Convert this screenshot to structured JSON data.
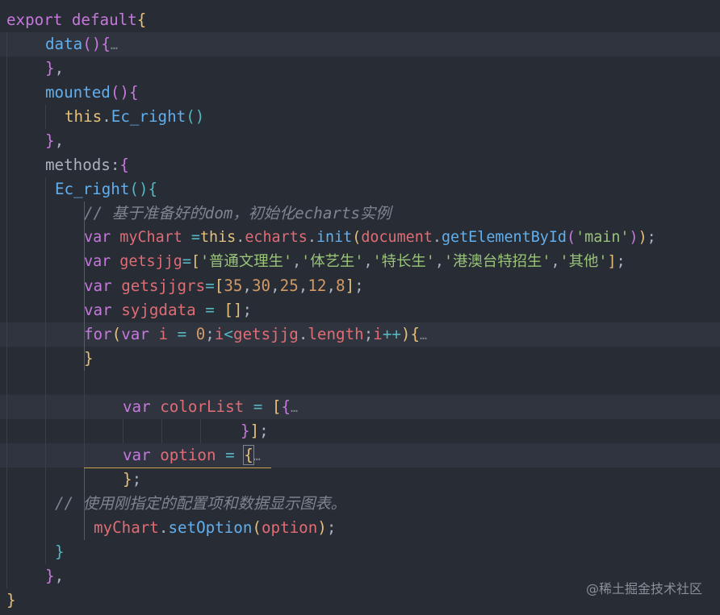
{
  "editor": {
    "lines": [
      {
        "id": "l1",
        "tokens": [
          [
            "kw",
            "export"
          ],
          [
            "plain",
            " "
          ],
          [
            "kw",
            "default"
          ],
          [
            "b1",
            "{"
          ]
        ]
      },
      {
        "id": "l2",
        "tokens": [
          [
            "fn",
            "data"
          ],
          [
            "b2",
            "()"
          ],
          [
            "b2",
            "{"
          ],
          [
            "ellipsis",
            "…"
          ]
        ]
      },
      {
        "id": "l3",
        "tokens": [
          [
            "b2",
            "}"
          ],
          [
            "plain",
            ","
          ]
        ]
      },
      {
        "id": "l4",
        "tokens": [
          [
            "fn",
            "mounted"
          ],
          [
            "b2",
            "()"
          ],
          [
            "b2",
            "{"
          ]
        ]
      },
      {
        "id": "l5",
        "tokens": [
          [
            "this",
            "this"
          ],
          [
            "plain",
            "."
          ],
          [
            "fn",
            "Ec_right"
          ],
          [
            "b3",
            "()"
          ]
        ]
      },
      {
        "id": "l6",
        "tokens": [
          [
            "b2",
            "}"
          ],
          [
            "plain",
            ","
          ]
        ]
      },
      {
        "id": "l7",
        "tokens": [
          [
            "plain",
            "methods:"
          ],
          [
            "b2",
            "{"
          ]
        ]
      },
      {
        "id": "l8",
        "tokens": [
          [
            "fn",
            "Ec_right"
          ],
          [
            "b3",
            "()"
          ],
          [
            "b3",
            "{"
          ]
        ]
      },
      {
        "id": "l9",
        "tokens": [
          [
            "cmt",
            "// 基于准备好的dom，初始化echarts实例"
          ]
        ]
      },
      {
        "id": "l10",
        "tokens": [
          [
            "kw",
            "var"
          ],
          [
            "plain",
            " "
          ],
          [
            "var",
            "myChart"
          ],
          [
            "plain",
            " "
          ],
          [
            "op",
            "="
          ],
          [
            "this",
            "this"
          ],
          [
            "plain",
            "."
          ],
          [
            "var",
            "echarts"
          ],
          [
            "plain",
            "."
          ],
          [
            "fn",
            "init"
          ],
          [
            "b1",
            "("
          ],
          [
            "var",
            "document"
          ],
          [
            "plain",
            "."
          ],
          [
            "fn",
            "getElementById"
          ],
          [
            "b2",
            "("
          ],
          [
            "str",
            "'main'"
          ],
          [
            "b2",
            ")"
          ],
          [
            "b1",
            ")"
          ],
          [
            "plain",
            ";"
          ]
        ]
      },
      {
        "id": "l11",
        "tokens": [
          [
            "kw",
            "var"
          ],
          [
            "plain",
            " "
          ],
          [
            "var",
            "getsjjg"
          ],
          [
            "op",
            "="
          ],
          [
            "b1",
            "["
          ],
          [
            "str",
            "'普通文理生'"
          ],
          [
            "plain",
            ","
          ],
          [
            "str",
            "'体艺生'"
          ],
          [
            "plain",
            ","
          ],
          [
            "str",
            "'特长生'"
          ],
          [
            "plain",
            ","
          ],
          [
            "str",
            "'港澳台特招生'"
          ],
          [
            "plain",
            ","
          ],
          [
            "str",
            "'其他'"
          ],
          [
            "b1",
            "]"
          ],
          [
            "plain",
            ";"
          ]
        ]
      },
      {
        "id": "l12",
        "tokens": [
          [
            "kw",
            "var"
          ],
          [
            "plain",
            " "
          ],
          [
            "var",
            "getsjjgrs"
          ],
          [
            "op",
            "="
          ],
          [
            "b1",
            "["
          ],
          [
            "num",
            "35"
          ],
          [
            "plain",
            ","
          ],
          [
            "num",
            "30"
          ],
          [
            "plain",
            ","
          ],
          [
            "num",
            "25"
          ],
          [
            "plain",
            ","
          ],
          [
            "num",
            "12"
          ],
          [
            "plain",
            ","
          ],
          [
            "num",
            "8"
          ],
          [
            "b1",
            "]"
          ],
          [
            "plain",
            ";"
          ]
        ]
      },
      {
        "id": "l13",
        "tokens": [
          [
            "kw",
            "var"
          ],
          [
            "plain",
            " "
          ],
          [
            "var",
            "syjgdata"
          ],
          [
            "plain",
            " "
          ],
          [
            "op",
            "="
          ],
          [
            "plain",
            " "
          ],
          [
            "b1",
            "[]"
          ],
          [
            "plain",
            ";"
          ]
        ]
      },
      {
        "id": "l14",
        "tokens": [
          [
            "kw",
            "for"
          ],
          [
            "b1",
            "("
          ],
          [
            "kw",
            "var"
          ],
          [
            "plain",
            " "
          ],
          [
            "var",
            "i"
          ],
          [
            "plain",
            " "
          ],
          [
            "op",
            "="
          ],
          [
            "plain",
            " "
          ],
          [
            "num",
            "0"
          ],
          [
            "plain",
            ";"
          ],
          [
            "var",
            "i"
          ],
          [
            "op",
            "<"
          ],
          [
            "var",
            "getsjjg"
          ],
          [
            "plain",
            "."
          ],
          [
            "var",
            "length"
          ],
          [
            "plain",
            ";"
          ],
          [
            "var",
            "i"
          ],
          [
            "op",
            "++"
          ],
          [
            "b1",
            ")"
          ],
          [
            "b1",
            "{"
          ],
          [
            "ellipsis",
            "…"
          ]
        ]
      },
      {
        "id": "l15",
        "tokens": [
          [
            "b1",
            "}"
          ]
        ]
      },
      {
        "id": "l16",
        "tokens": []
      },
      {
        "id": "l17",
        "tokens": [
          [
            "kw",
            "var"
          ],
          [
            "plain",
            " "
          ],
          [
            "var",
            "colorList"
          ],
          [
            "plain",
            " "
          ],
          [
            "op",
            "="
          ],
          [
            "plain",
            " "
          ],
          [
            "b1",
            "["
          ],
          [
            "b2",
            "{"
          ],
          [
            "ellipsis",
            "…"
          ]
        ]
      },
      {
        "id": "l18",
        "tokens": [
          [
            "b2",
            "}"
          ],
          [
            "b1",
            "]"
          ],
          [
            "plain",
            ";"
          ]
        ]
      },
      {
        "id": "l19",
        "tokens": [
          [
            "kw",
            "var"
          ],
          [
            "plain",
            " "
          ],
          [
            "var",
            "option"
          ],
          [
            "plain",
            " "
          ],
          [
            "op",
            "="
          ],
          [
            "plain",
            " "
          ],
          [
            "b1",
            "{"
          ],
          [
            "ellipsis",
            "…"
          ]
        ]
      },
      {
        "id": "l20",
        "tokens": [
          [
            "b1",
            "}"
          ],
          [
            "plain",
            ";"
          ]
        ]
      },
      {
        "id": "l21",
        "tokens": [
          [
            "cmt",
            "// 使用刚指定的配置项和数据显示图表。"
          ]
        ]
      },
      {
        "id": "l22",
        "tokens": [
          [
            "var",
            "myChart"
          ],
          [
            "plain",
            "."
          ],
          [
            "fn",
            "setOption"
          ],
          [
            "b1",
            "("
          ],
          [
            "var",
            "option"
          ],
          [
            "b1",
            ")"
          ],
          [
            "plain",
            ";"
          ]
        ]
      },
      {
        "id": "l23",
        "tokens": [
          [
            "b3",
            "}"
          ]
        ]
      },
      {
        "id": "l24",
        "tokens": [
          [
            "b2",
            "}"
          ],
          [
            "plain",
            ","
          ]
        ]
      },
      {
        "id": "l25",
        "tokens": [
          [
            "b1",
            "}"
          ]
        ]
      }
    ]
  },
  "watermark": {
    "text": "@稀土掘金技术社区"
  },
  "colors": {
    "background": "#282c34",
    "keyword": "#c678dd",
    "function": "#61afef",
    "string": "#98c379",
    "number": "#d19a66",
    "variable": "#e06c75",
    "comment": "#7f848e"
  }
}
